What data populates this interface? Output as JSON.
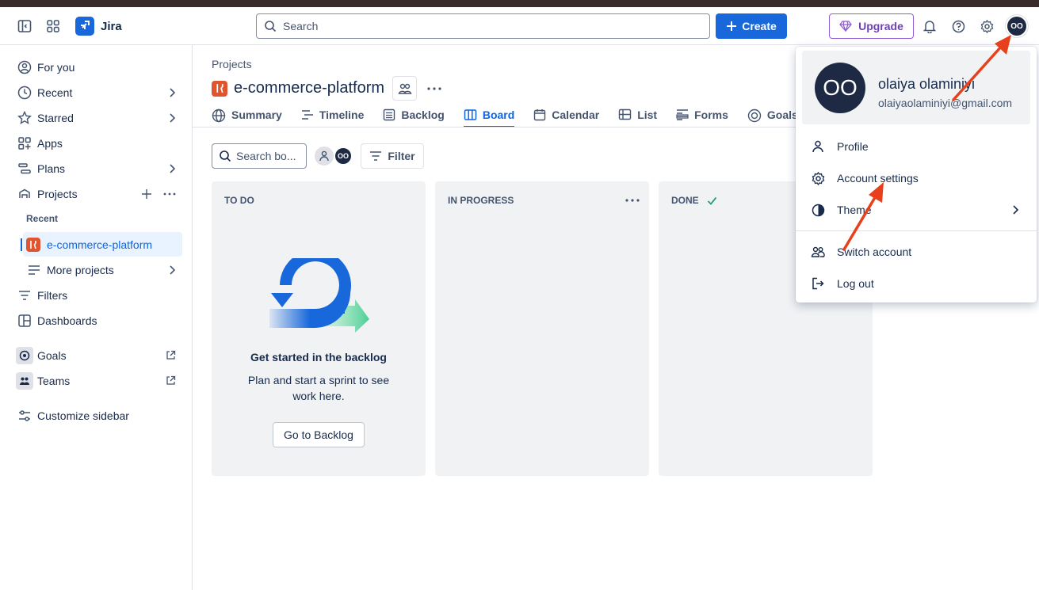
{
  "topbar": {
    "app_name": "Jira",
    "search_placeholder": "Search",
    "create_label": "Create",
    "upgrade_label": "Upgrade",
    "avatar_initials": "OO"
  },
  "sidebar": {
    "items": [
      {
        "label": "For you",
        "icon": "person-circle-icon"
      },
      {
        "label": "Recent",
        "icon": "clock-icon"
      },
      {
        "label": "Starred",
        "icon": "star-icon"
      },
      {
        "label": "Apps",
        "icon": "apps-icon"
      },
      {
        "label": "Plans",
        "icon": "plans-icon"
      },
      {
        "label": "Projects",
        "icon": "projects-icon"
      }
    ],
    "recent_label": "Recent",
    "active_project": "e-commerce-platform",
    "more_projects": "More projects",
    "filters": "Filters",
    "dashboards": "Dashboards",
    "goals": "Goals",
    "teams": "Teams",
    "customize": "Customize sidebar"
  },
  "project": {
    "breadcrumb": "Projects",
    "title": "e-commerce-platform",
    "tabs": [
      "Summary",
      "Timeline",
      "Backlog",
      "Board",
      "Calendar",
      "List",
      "Forms",
      "Goals"
    ],
    "selected_tab": "Board"
  },
  "board": {
    "search_placeholder": "Search bo...",
    "avatar_initials": "OO",
    "filter_label": "Filter",
    "columns": [
      "TO DO",
      "IN PROGRESS",
      "DONE"
    ],
    "empty_title": "Get started in the backlog",
    "empty_body": "Plan and start a sprint to see work here.",
    "empty_button": "Go to Backlog"
  },
  "account_menu": {
    "initials": "OO",
    "name": "olaiya olaminiyi",
    "email": "olaiyaolaminiyi@gmail.com",
    "items": [
      "Profile",
      "Account settings",
      "Theme",
      "Switch account",
      "Log out"
    ]
  },
  "colors": {
    "primary": "#1868db",
    "upgrade": "#8f5ed1",
    "annotation_arrow": "#e8401c"
  }
}
